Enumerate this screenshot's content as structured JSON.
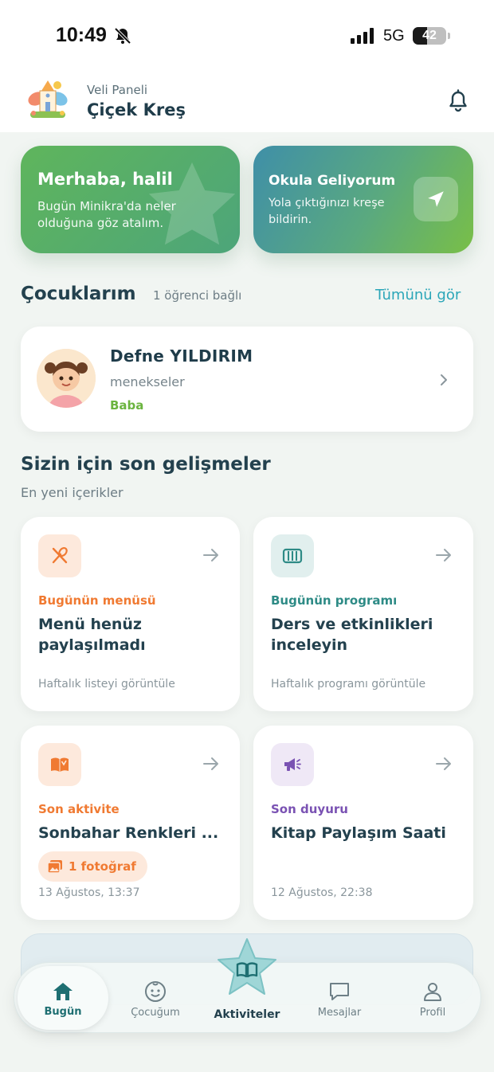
{
  "status_bar": {
    "time": "10:49",
    "network": "5G",
    "battery": "42",
    "battery_level": 0.42
  },
  "header": {
    "subtitle": "Veli Paneli",
    "title": "Çiçek Kreş"
  },
  "hero": {
    "greeting": {
      "title": "Merhaba, halil",
      "text": "Bugün Minikra'da neler olduğuna göz atalım."
    },
    "arrival": {
      "title": "Okula Geliyorum",
      "text": "Yola çıktığınızı kreşe bildirin."
    }
  },
  "children": {
    "title": "Çocuklarım",
    "count": "1 öğrenci bağlı",
    "see_all": "Tümünü gör",
    "items": [
      {
        "name": "Defne YILDIRIM",
        "class": "menekseler",
        "relation": "Baba"
      }
    ]
  },
  "updates": {
    "title": "Sizin için son gelişmeler",
    "subtitle": "En yeni içerikler",
    "cards": [
      {
        "category": "Bugünün menüsü",
        "title": "Menü henüz\npaylaşılmadı",
        "footer": "Haftalık listeyi görüntüle",
        "icon": "utensils-icon",
        "accent": "#f07a32"
      },
      {
        "category": "Bugünün programı",
        "title": "Ders ve etkinlikleri\ninceleyin",
        "footer": "Haftalık programı görüntüle",
        "icon": "schedule-icon",
        "accent": "#2e8b86"
      },
      {
        "category": "Son aktivite",
        "title": "Sonbahar Renkleri ...",
        "badge": "1 fotoğraf",
        "footer": "13 Ağustos, 13:37",
        "icon": "open-book-icon",
        "accent": "#f07a32"
      },
      {
        "category": "Son duyuru",
        "title": "Kitap Paylaşım Saati",
        "footer": "12 Ağustos, 22:38",
        "icon": "megaphone-icon",
        "accent": "#7a52b3"
      }
    ]
  },
  "bottom_nav": {
    "items": [
      {
        "label": "Bugün",
        "icon": "home-icon"
      },
      {
        "label": "Çocuğum",
        "icon": "child-face-icon"
      },
      {
        "label": "Aktiviteler",
        "icon": "star-book-icon"
      },
      {
        "label": "Mesajlar",
        "icon": "chat-icon"
      },
      {
        "label": "Profil",
        "icon": "user-icon"
      }
    ]
  }
}
